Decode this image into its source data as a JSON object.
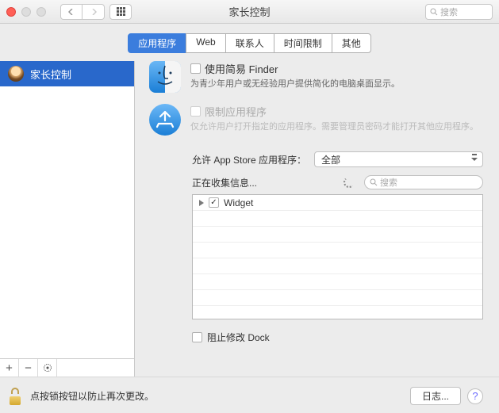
{
  "titlebar": {
    "title": "家长控制",
    "search_placeholder": "搜索"
  },
  "tabs": [
    "应用程序",
    "Web",
    "联系人",
    "时间限制",
    "其他"
  ],
  "active_tab": 0,
  "sidebar": {
    "items": [
      {
        "label": "家长控制"
      }
    ],
    "buttons": {
      "add": "+",
      "remove": "−",
      "action": "✻"
    }
  },
  "options": {
    "simple_finder": {
      "title": "使用简易 Finder",
      "desc": "为青少年用户或无经验用户提供简化的电脑桌面显示。",
      "checked": false
    },
    "limit_apps": {
      "title": "限制应用程序",
      "desc": "仅允许用户打开指定的应用程序。需要管理员密码才能打开其他应用程序。",
      "checked": false,
      "disabled": true
    }
  },
  "appstore": {
    "label": "允许 App Store 应用程序：",
    "selected": "全部"
  },
  "collecting": {
    "label": "正在收集信息...",
    "search_placeholder": "搜索"
  },
  "list": {
    "items": [
      {
        "label": "Widget",
        "checked": true
      }
    ]
  },
  "dock": {
    "label": "阻止修改 Dock",
    "checked": false
  },
  "footer": {
    "lock_text": "点按锁按钮以防止再次更改。",
    "log_button": "日志...",
    "help": "?"
  }
}
